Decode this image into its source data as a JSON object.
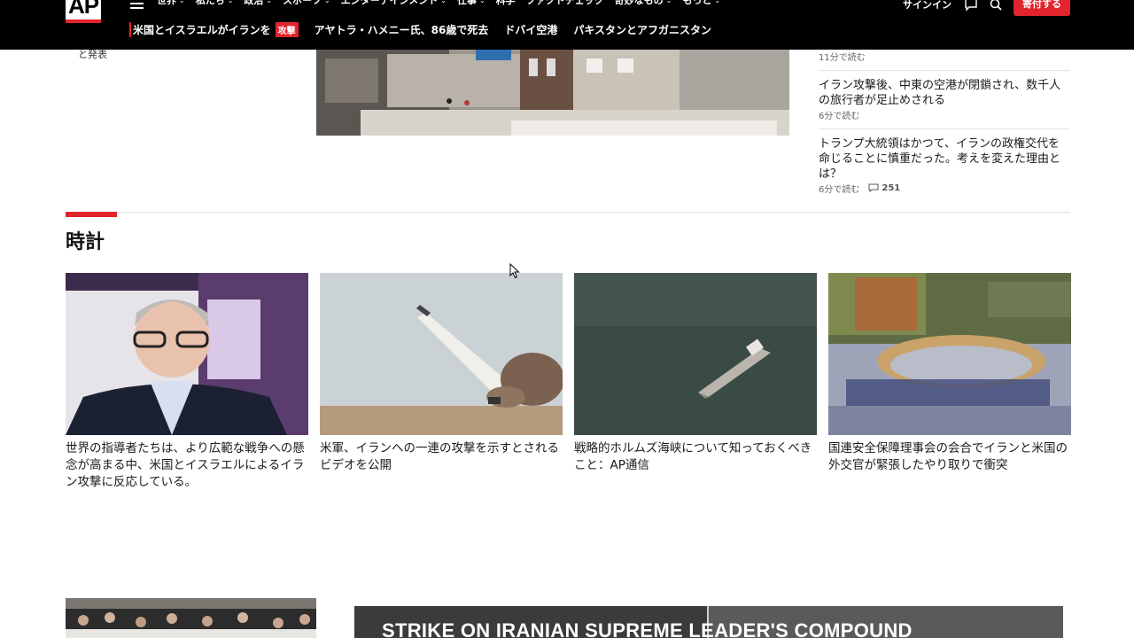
{
  "header": {
    "logo": "AP",
    "nav": [
      {
        "label": "世界",
        "chevron": true
      },
      {
        "label": "私たち",
        "chevron": true
      },
      {
        "label": "政治",
        "chevron": true
      },
      {
        "label": "スポーツ",
        "chevron": true
      },
      {
        "label": "エンターテインメント",
        "chevron": true
      },
      {
        "label": "仕事",
        "chevron": true
      },
      {
        "label": "科学",
        "chevron": false
      },
      {
        "label": "ファクトチェック",
        "chevron": false
      },
      {
        "label": "奇妙なもの",
        "chevron": true
      },
      {
        "label": "もっと",
        "chevron": true
      }
    ],
    "signin": "サインイン",
    "donate": "寄付する",
    "trending": [
      {
        "label": "米国とイスラエルがイランを",
        "badge": "攻撃"
      },
      {
        "label": "アヤトラ・ハメニー氏、86歳で死去"
      },
      {
        "label": "ドバイ空港"
      },
      {
        "label": "パキスタンとアフガニスタン"
      }
    ]
  },
  "top": {
    "left_fragment": "と発表",
    "side": {
      "first_meta": "11分で読む",
      "items": [
        {
          "title": "イラン攻撃後、中東の空港が閉鎖され、数千人の旅行者が足止めされる",
          "meta": "6分で読む",
          "comments": ""
        },
        {
          "title": "トランプ大統領はかつて、イランの政権交代を命じることに慎重だった。考えを変えた理由とは？",
          "meta": "6分で読む",
          "comments": "251"
        }
      ]
    }
  },
  "watch": {
    "title": "時計",
    "cards": [
      {
        "title": "世界の指導者たちは、より広範な戦争への懸念が高まる中、米国とイスラエルによるイラン攻撃に反応している。"
      },
      {
        "title": "米軍、イランへの一連の攻撃を示すとされるビデオを公開"
      },
      {
        "title": "戦略的ホルムズ海峡について知っておくべきこと：AP通信"
      },
      {
        "title": "国連安全保障理事会の会合でイランと米国の外交官が緊張したやり取りで衝突"
      }
    ]
  },
  "bottom": {
    "video_caption": "STRIKE ON IRANIAN SUPREME LEADER'S COMPOUND"
  },
  "colors": {
    "accent": "#e2242d",
    "header_bg": "#000000"
  }
}
